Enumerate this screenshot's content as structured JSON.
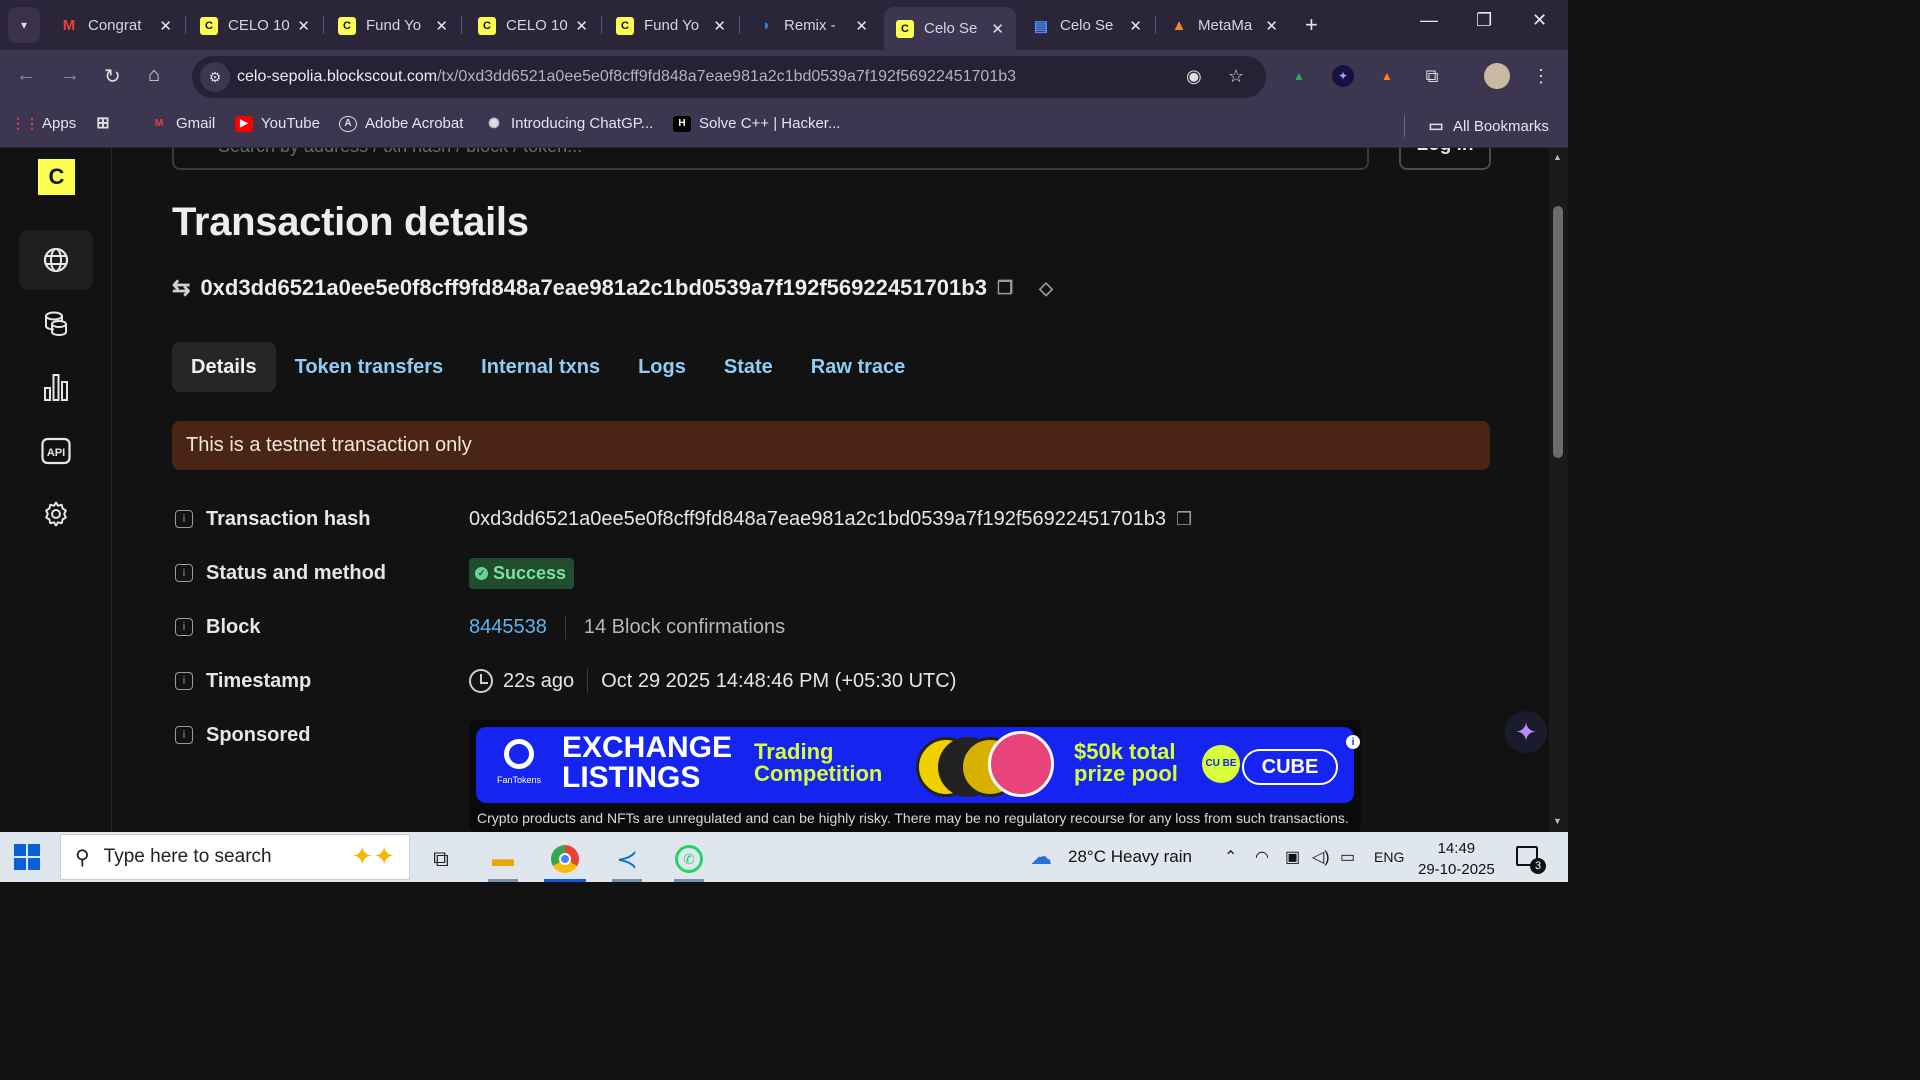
{
  "browser": {
    "tabs": [
      {
        "title": "Congrat",
        "icon": "gmail-icon",
        "color": "#ea4335",
        "glyph": "M"
      },
      {
        "title": "CELO 10",
        "icon": "celo-icon",
        "color": "#fcff52",
        "glyph": "C"
      },
      {
        "title": "Fund Yo",
        "icon": "celo-icon",
        "color": "#fcff52",
        "glyph": "C"
      },
      {
        "title": "CELO 10",
        "icon": "celo-icon",
        "color": "#fcff52",
        "glyph": "C"
      },
      {
        "title": "Fund Yo",
        "icon": "celo-icon",
        "color": "#fcff52",
        "glyph": "C"
      },
      {
        "title": "Remix -",
        "icon": "remix-icon",
        "color": "#2b7bd8",
        "glyph": "◑"
      },
      {
        "title": "Celo Se",
        "icon": "celo-icon",
        "color": "#fcff52",
        "glyph": "C",
        "active": true
      },
      {
        "title": "Celo Se",
        "icon": "doc-icon",
        "color": "#4f8bf5",
        "glyph": "▤"
      },
      {
        "title": "MetaMa",
        "icon": "metamask-icon",
        "color": "#f6851b",
        "glyph": "▲"
      }
    ],
    "url_host": "celo-sepolia.blockscout.com",
    "url_path": "/tx/0xd3dd6521a0ee5e0f8cff9fd848a7eae981a2c1bd0539a7f192f56922451701b3",
    "bookmarks": [
      {
        "label": "Apps",
        "icon": "apps-grid-icon"
      },
      {
        "label": "Gmail",
        "icon": "gmail-icon"
      },
      {
        "label": "YouTube",
        "icon": "youtube-icon"
      },
      {
        "label": "Adobe Acrobat",
        "icon": "acrobat-icon"
      },
      {
        "label": "Introducing ChatGP...",
        "icon": "openai-icon"
      },
      {
        "label": "Solve C++ | Hacker...",
        "icon": "hackerrank-icon"
      }
    ],
    "all_bookmarks": "All Bookmarks"
  },
  "page": {
    "search_placeholder": "Search by address / txn hash / block / token...",
    "login_label": "Log in",
    "title": "Transaction details",
    "tx_hash": "0xd3dd6521a0ee5e0f8cff9fd848a7eae981a2c1bd0539a7f192f56922451701b3",
    "tabs": [
      "Details",
      "Token transfers",
      "Internal txns",
      "Logs",
      "State",
      "Raw trace"
    ],
    "alert": "This is a testnet transaction only",
    "fields": {
      "hash_label": "Transaction hash",
      "status_label": "Status and method",
      "status_value": "Success",
      "block_label": "Block",
      "block_number": "8445538",
      "block_confirmations": "14 Block confirmations",
      "timestamp_label": "Timestamp",
      "timestamp_relative": "22s ago",
      "timestamp_absolute": "Oct 29 2025 14:48:46 PM (+05:30 UTC)",
      "sponsored_label": "Sponsored"
    },
    "ad": {
      "brand": "FanTokens",
      "headline_1": "EXCHANGE",
      "headline_2": "LISTINGS",
      "sub_1": "Trading",
      "sub_2": "Competition",
      "prize_1": "$50k total",
      "prize_2": "prize pool",
      "cube_ball": "CU BE",
      "cube": "CUBE",
      "disclaimer": "Crypto products and NFTs are unregulated and can be highly risky. There may be no regulatory recourse for any loss from such transactions."
    }
  },
  "taskbar": {
    "search_placeholder": "Type here to search",
    "weather": "28°C  Heavy rain",
    "language": "ENG",
    "time": "14:49",
    "date": "29-10-2025",
    "notifications": "3"
  }
}
